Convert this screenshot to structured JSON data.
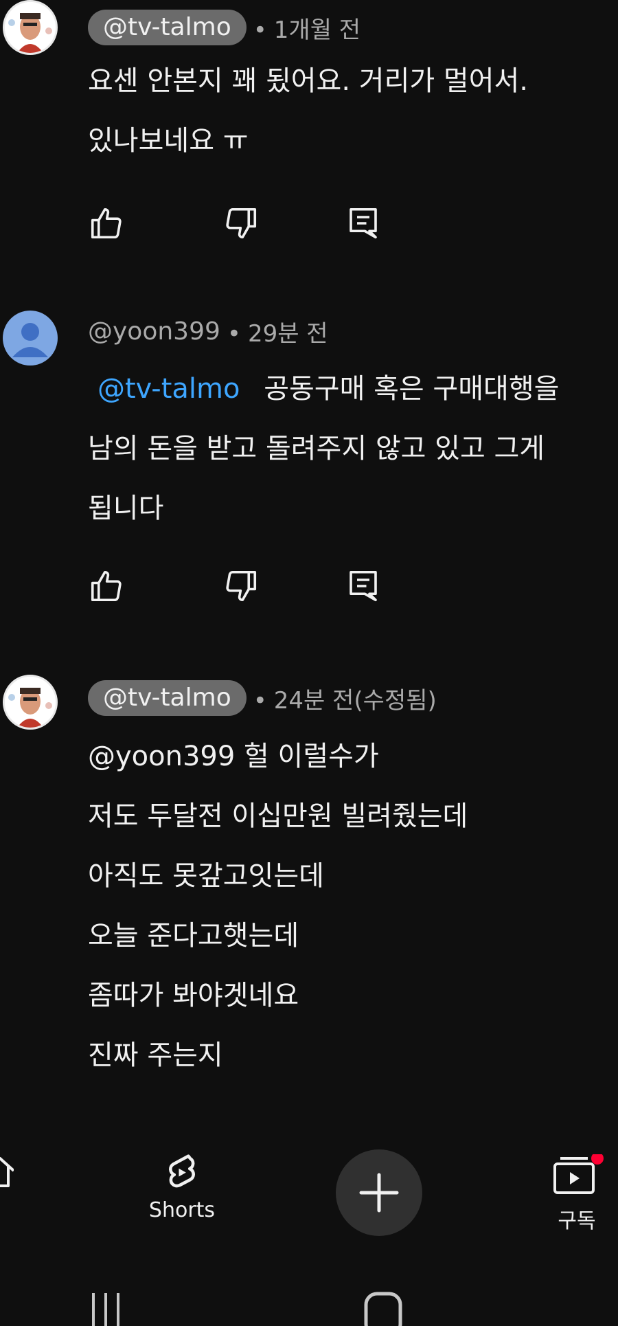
{
  "comments": [
    {
      "handle": "@tv-talmo",
      "time": "1개월 전",
      "lines": [
        "요센 안본지 꽤 됬어요. 거리가 멀어서.",
        "있나보네요 ㅠ"
      ]
    },
    {
      "handle": "@yoon399",
      "time": "29분 전",
      "mention": "@tv-talmo",
      "first_line_text": "공동구매 혹은 구매대행을",
      "lines": [
        "남의 돈을 받고 돌려주지 않고 있고 그게",
        "됩니다"
      ]
    },
    {
      "handle": "@tv-talmo",
      "time": "24분 전(수정됨)",
      "lines": [
        "@yoon399  헐 이럴수가",
        "저도 두달전 이십만원 빌려줬는데",
        "아직도 못갚고잇는데",
        "오늘 준다고햇는데",
        "좀따가 봐야겟네요",
        "진짜 주는지"
      ]
    }
  ],
  "separator": "•",
  "nav": {
    "shorts_label": "Shorts",
    "subscriptions_label": "구독",
    "icons": [
      "home-icon",
      "shorts-icon",
      "create-icon",
      "subscriptions-icon"
    ]
  },
  "colors": {
    "background": "#0f0f0f",
    "mention": "#3ea6ff",
    "pill": "#6b6b6b",
    "notification_dot": "#ff0033"
  }
}
